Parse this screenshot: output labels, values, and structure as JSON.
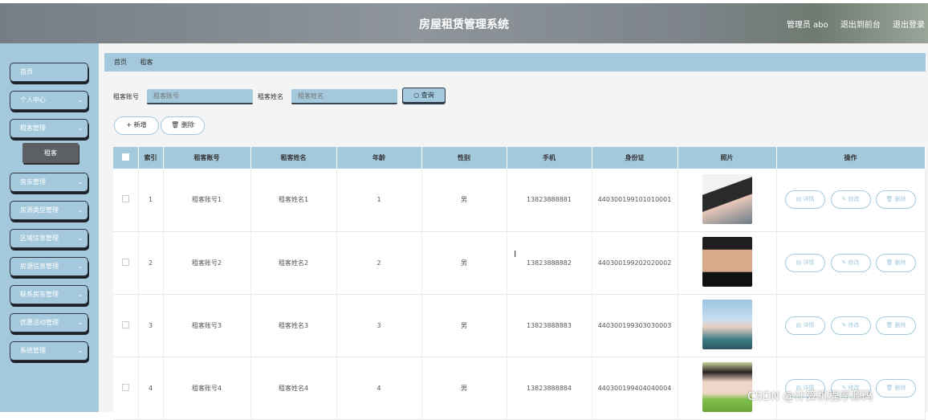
{
  "header": {
    "title": "房屋租赁管理系统",
    "user": "管理员 abo",
    "front": "退出到前台",
    "logout": "退出登录"
  },
  "sidebar": {
    "items": [
      {
        "label": "首页",
        "chevron": ""
      },
      {
        "label": "个人中心",
        "chevron": "⌄"
      },
      {
        "label": "租客管理",
        "chevron": "⌄"
      },
      {
        "label": "房东管理",
        "chevron": "⌄"
      },
      {
        "label": "房源类型管理",
        "chevron": "⌄"
      },
      {
        "label": "区域信息管理",
        "chevron": "⌄"
      },
      {
        "label": "房源信息管理",
        "chevron": "⌄"
      },
      {
        "label": "联系房东管理",
        "chevron": "⌄"
      },
      {
        "label": "优惠活动管理",
        "chevron": "⌄"
      },
      {
        "label": "系统管理",
        "chevron": "⌄"
      }
    ],
    "sub_active": "租客"
  },
  "breadcrumb": {
    "home": "首页",
    "current": "租客"
  },
  "search": {
    "account_label": "租客账号",
    "account_placeholder": "租客账号",
    "name_label": "租客姓名",
    "name_placeholder": "租客姓名",
    "query": "查询"
  },
  "toolbar": {
    "add": "+ 新增",
    "delete": "删除"
  },
  "table": {
    "headers": [
      "",
      "索引",
      "租客账号",
      "租客姓名",
      "年龄",
      "性别",
      "手机",
      "身份证",
      "照片",
      "操作"
    ],
    "rows": [
      {
        "index": "1",
        "account": "租客账号1",
        "name": "租客姓名1",
        "age": "1",
        "gender": "男",
        "phone": "13823888881",
        "id": "440300199101010001"
      },
      {
        "index": "2",
        "account": "租客账号2",
        "name": "租客姓名2",
        "age": "2",
        "gender": "男",
        "phone": "13823888882",
        "id": "440300199202020002"
      },
      {
        "index": "3",
        "account": "租客账号3",
        "name": "租客姓名3",
        "age": "3",
        "gender": "男",
        "phone": "13823888883",
        "id": "440300199303030003"
      },
      {
        "index": "4",
        "account": "租客账号4",
        "name": "租客姓名4",
        "age": "4",
        "gender": "男",
        "phone": "13823888884",
        "id": "440300199404040004"
      }
    ],
    "actions": {
      "detail": "详情",
      "edit": "修改",
      "delete": "删除"
    }
  },
  "watermark": "CSDN @计算机程序源码",
  "colors": {
    "accent": "#a4c9dd",
    "header": "#8e959b"
  }
}
